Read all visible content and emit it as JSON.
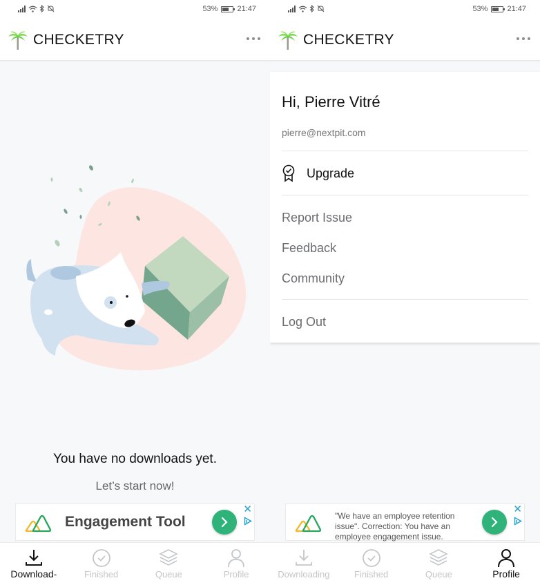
{
  "status_bar": {
    "battery_percent": "53%",
    "time": "21:47",
    "icons": [
      "signal-icon",
      "wifi-icon",
      "bluetooth-icon",
      "notifications-off-icon",
      "battery-icon"
    ]
  },
  "app": {
    "title": "CHECKETRY",
    "logo_icon": "palm-tree-icon",
    "more_icon": "more-horizontal-icon"
  },
  "left_screen": {
    "empty_state": {
      "title": "You have no downloads yet.",
      "subtitle": "Let’s start now!",
      "illustration": "dog-with-box-illustration"
    },
    "ad": {
      "headline": "Engagement Tool",
      "close_icon": "close-icon",
      "adchoices_icon": "adchoices-icon",
      "go_icon": "chevron-right-icon"
    },
    "bottom_nav": [
      {
        "label": "Download-",
        "icon": "download-icon",
        "active": true
      },
      {
        "label": "Finished",
        "icon": "check-circle-icon",
        "active": false
      },
      {
        "label": "Queue",
        "icon": "layers-icon",
        "active": false
      },
      {
        "label": "Profile",
        "icon": "user-icon",
        "active": false
      }
    ]
  },
  "right_screen": {
    "profile_menu": {
      "greeting": "Hi, Pierre Vitré",
      "email": "pierre@nextpit.com",
      "upgrade": {
        "label": "Upgrade",
        "icon": "award-badge-icon"
      },
      "items": [
        "Report Issue",
        "Feedback",
        "Community"
      ],
      "logout": "Log Out"
    },
    "ad": {
      "body": "\"We have an employee retention issue\". Correction: You have an employee engagement issue.",
      "close_icon": "close-icon",
      "adchoices_icon": "adchoices-icon",
      "go_icon": "chevron-right-icon"
    },
    "bottom_nav": [
      {
        "label": "Downloading",
        "icon": "download-icon",
        "active": false
      },
      {
        "label": "Finished",
        "icon": "check-circle-icon",
        "active": false
      },
      {
        "label": "Queue",
        "icon": "layers-icon",
        "active": false
      },
      {
        "label": "Profile",
        "icon": "user-icon",
        "active": true
      }
    ]
  },
  "colors": {
    "accent_green": "#2fb37a",
    "logo_green": "#7ed957",
    "ad_blue": "#1a9fd6",
    "inactive_nav": "#c4c6c9",
    "background": "#f7f8fa"
  }
}
